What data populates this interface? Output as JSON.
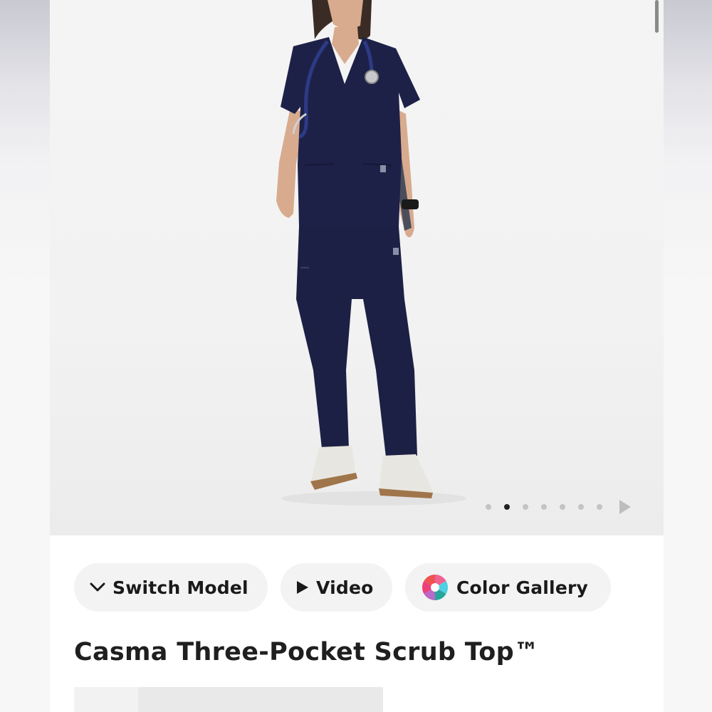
{
  "carousel": {
    "slide_count": 7,
    "active_index": 1,
    "image_alt": "Model wearing navy scrub top and pants with stethoscope"
  },
  "actions": {
    "switch_model_label": "Switch Model",
    "video_label": "Video",
    "color_gallery_label": "Color Gallery"
  },
  "product": {
    "title": "Casma Three-Pocket Scrub Top™"
  },
  "icons": {
    "switch_model": "chevron-down-icon",
    "video": "play-icon",
    "color_gallery": "color-wheel-icon",
    "next": "next-arrow-icon"
  },
  "colors": {
    "scrub_navy": "#1e2147",
    "accent_text": "#1a1a1a",
    "pill_bg": "#f3f3f3"
  }
}
